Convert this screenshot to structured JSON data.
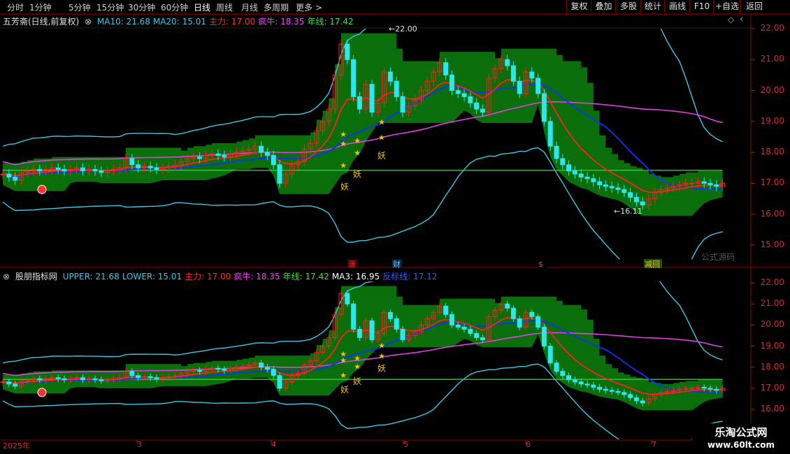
{
  "toolbar": {
    "timeframes": [
      "分时",
      "1分钟",
      "5分钟",
      "15分钟",
      "30分钟",
      "60分钟",
      "日线",
      "周线",
      "月线",
      "多周期",
      "更多 >"
    ],
    "active_timeframe": "日线",
    "right_buttons": [
      "复权",
      "叠加",
      "多股",
      "统计",
      "画线",
      "F10",
      "+自选",
      "返回"
    ]
  },
  "panel1": {
    "stock_label": "五芳斋(日线,前复权)",
    "indicators": [
      {
        "text": "MA10: 21.68",
        "color": "#3ec8e6"
      },
      {
        "text": "MA20: 15.01",
        "color": "#3ec8e6"
      },
      {
        "text": "主力: 17.00",
        "color": "#ff3030"
      },
      {
        "text": "疯牛: 18.35",
        "color": "#ff40ff"
      },
      {
        "text": "年线: 17.42",
        "color": "#40e040"
      }
    ],
    "y_ticks": [
      "22.00",
      "21.00",
      "20.00",
      "19.00",
      "18.00",
      "17.00",
      "16.00",
      "15.00"
    ],
    "high_label": "22.00",
    "low_label": "16.11",
    "watermark": "公式源码",
    "signals": [
      "涨",
      "财",
      "$",
      "减回"
    ],
    "star_labels": [
      "妖",
      "妖",
      "妖"
    ]
  },
  "panel2": {
    "name": "股朋指标网",
    "indicators": [
      {
        "text": "UPPER: 21.68",
        "color": "#3ec8e6"
      },
      {
        "text": "LOWER: 15.01",
        "color": "#3ec8e6"
      },
      {
        "text": "主力: 17.00",
        "color": "#ff3030"
      },
      {
        "text": "疯牛: 18.35",
        "color": "#ff40ff"
      },
      {
        "text": "年线: 17.42",
        "color": "#40e040"
      },
      {
        "text": "MA3: 16.95",
        "color": "#ffffff"
      },
      {
        "text": "反标线: 17.12",
        "color": "#3060ff"
      }
    ],
    "y_ticks": [
      "22.00",
      "21.00",
      "20.00",
      "19.00",
      "18.00",
      "17.00",
      "16.00"
    ],
    "star_labels": [
      "妖",
      "妖",
      "妖"
    ]
  },
  "x_axis": {
    "labels": [
      "2025年",
      "3",
      "4",
      "5",
      "6",
      "7"
    ]
  },
  "footer": {
    "site_name": "乐淘公式网",
    "site_url": "www.60lt.com"
  },
  "colors": {
    "up": "#ff2020",
    "down": "#28e8f0",
    "band": "#0a6e0a",
    "zhuli": "#ff2020",
    "fengniu": "#e040e0",
    "nianxian": "#30d030",
    "blue": "#1030ff",
    "bollinger": "#3ec8e6"
  }
}
